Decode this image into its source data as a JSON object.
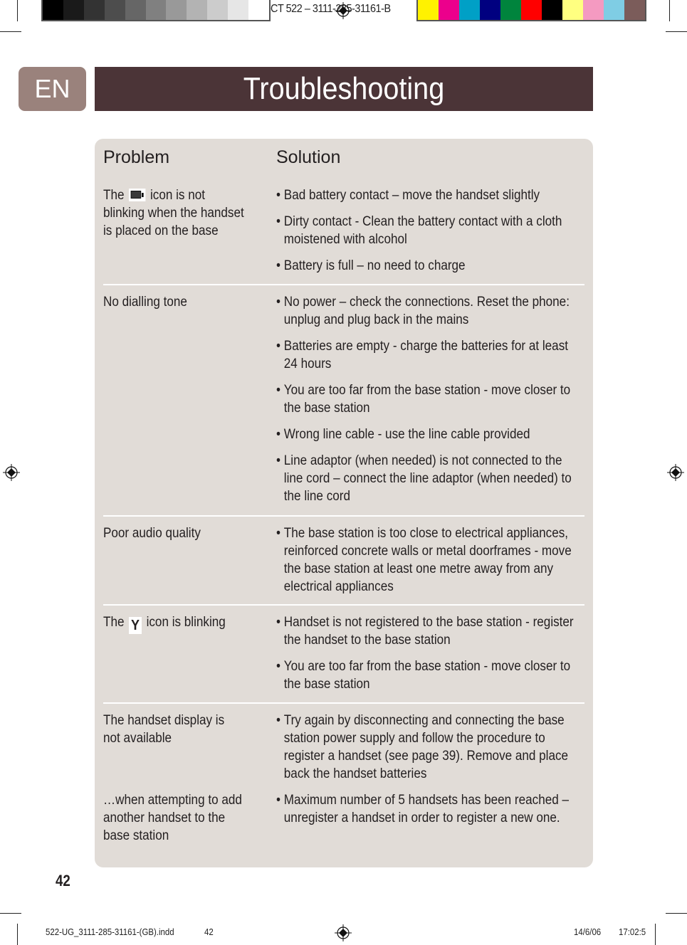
{
  "print_marks": {
    "slug_top": "CT 522  –   3111-285-31161-B",
    "gray_swatches": [
      "#000000",
      "#1a1a1a",
      "#333333",
      "#4d4d4d",
      "#666666",
      "#808080",
      "#999999",
      "#b3b3b3",
      "#cccccc",
      "#e6e6e6",
      "#ffffff"
    ],
    "color_swatches": [
      "#fff200",
      "#ec008c",
      "#00a0c6",
      "#000080",
      "#00843d",
      "#ff0000",
      "#000000",
      "#ffff80",
      "#f49ac1",
      "#7fcde4",
      "#7b5c5a"
    ],
    "slug_bottom_file": "522-UG_3111-285-31161-(GB).indd",
    "slug_bottom_page": "42",
    "slug_bottom_date": "14/6/06",
    "slug_bottom_time": "17:02:5"
  },
  "header": {
    "language_tab": "EN",
    "title": "Troubleshooting",
    "colors": {
      "language_tab": "#9a827c",
      "title_bar": "#4b3437",
      "panel": "#e1dcd7"
    }
  },
  "table": {
    "headers": {
      "problem": "Problem",
      "solution": "Solution"
    },
    "rows": [
      {
        "problem_pre": "The",
        "problem_icon": "battery-icon",
        "problem_post": "icon is not blinking when the handset is placed on the base",
        "solutions": [
          "Bad battery contact – move the handset slightly",
          "Dirty contact - Clean the battery contact with a cloth moistened with alcohol",
          "Battery is full – no need to charge"
        ]
      },
      {
        "problem": "No dialling tone",
        "solutions": [
          "No power – check the connections. Reset the phone: unplug and plug back in the mains",
          "Batteries are empty - charge the batteries for at least 24 hours",
          "You are too far from the base station - move closer to the base station",
          "Wrong line cable - use the line cable provided",
          "Line adaptor (when needed) is not connected to the line cord – connect the line adaptor (when needed) to the line cord"
        ]
      },
      {
        "problem": "Poor audio quality",
        "solutions": [
          "The base station is too close to electrical appliances, reinforced concrete walls or metal doorframes - move the base station at least one metre away from any electrical appliances"
        ]
      },
      {
        "problem_pre": "The",
        "problem_icon": "antenna-icon",
        "problem_post": "icon is blinking",
        "solutions": [
          "Handset is not registered to the base station - register the handset to the base station",
          "You are too far from the base station - move closer to the base station"
        ]
      },
      {
        "problem": "The handset display is not available",
        "solutions": [
          "Try again by disconnecting and connecting the base station power supply and follow the procedure to register a handset (see page 39). Remove and place back the handset batteries"
        ]
      },
      {
        "problem": "…when attempting to add another handset to the base station",
        "solutions": [
          "Maximum number of 5 handsets has been reached – unregister a handset in order to register a new one."
        ]
      }
    ]
  },
  "footer": {
    "page_number": "42"
  }
}
